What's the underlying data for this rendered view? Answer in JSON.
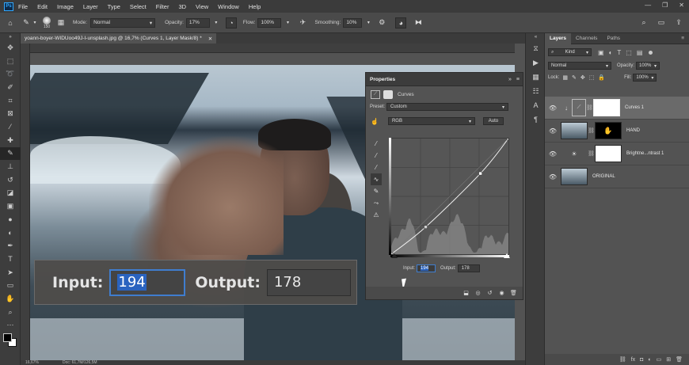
{
  "menubar": {
    "logo": "Ps",
    "items": [
      "File",
      "Edit",
      "Image",
      "Layer",
      "Type",
      "Select",
      "Filter",
      "3D",
      "View",
      "Window",
      "Help"
    ],
    "controls": [
      "—",
      "❐",
      "✕"
    ]
  },
  "options": {
    "brush_size": "150",
    "mode_label": "Mode:",
    "mode_value": "Normal",
    "opacity_label": "Opacity:",
    "opacity_value": "17%",
    "flow_label": "Flow:",
    "flow_value": "100%",
    "smoothing_label": "Smoothing:",
    "smoothing_value": "10%"
  },
  "document": {
    "tab_title": "yoann-boyer-WIDUoo49J-I-unsplash.jpg @ 16,7% (Curves 1, Layer Mask/8) *",
    "zoom": "16,67%",
    "doc_size": "Doc: 61,7M/126,5M"
  },
  "overlay": {
    "input_label": "Input:",
    "input_value": "194",
    "output_label": "Output:",
    "output_value": "178"
  },
  "properties": {
    "title": "Properties",
    "layer_type": "Curves",
    "preset_label": "Preset:",
    "preset_value": "Custom",
    "channel_value": "RGB",
    "auto_label": "Auto",
    "input_label": "Input:",
    "input_value": "194",
    "output_label": "Output:",
    "output_value": "178"
  },
  "layers": {
    "tabs": [
      "Layers",
      "Channels",
      "Paths"
    ],
    "kind_value": "Kind",
    "blend_value": "Normal",
    "opacity_label": "Opacity:",
    "opacity_value": "100%",
    "lock_label": "Lock:",
    "fill_label": "Fill:",
    "fill_value": "100%",
    "rows": [
      {
        "name": "Curves 1"
      },
      {
        "name": "HAND"
      },
      {
        "name": "Brightne...ntrast 1"
      },
      {
        "name": "ORIGINAL"
      }
    ]
  },
  "chart_data": {
    "type": "line",
    "title": "",
    "xlabel": "Input",
    "ylabel": "Output",
    "xlim": [
      0,
      255
    ],
    "ylim": [
      0,
      255
    ],
    "grid": true,
    "series": [
      {
        "values": [
          [
            0,
            0
          ],
          [
            75,
            60
          ],
          [
            194,
            178
          ],
          [
            255,
            255
          ]
        ]
      }
    ]
  }
}
